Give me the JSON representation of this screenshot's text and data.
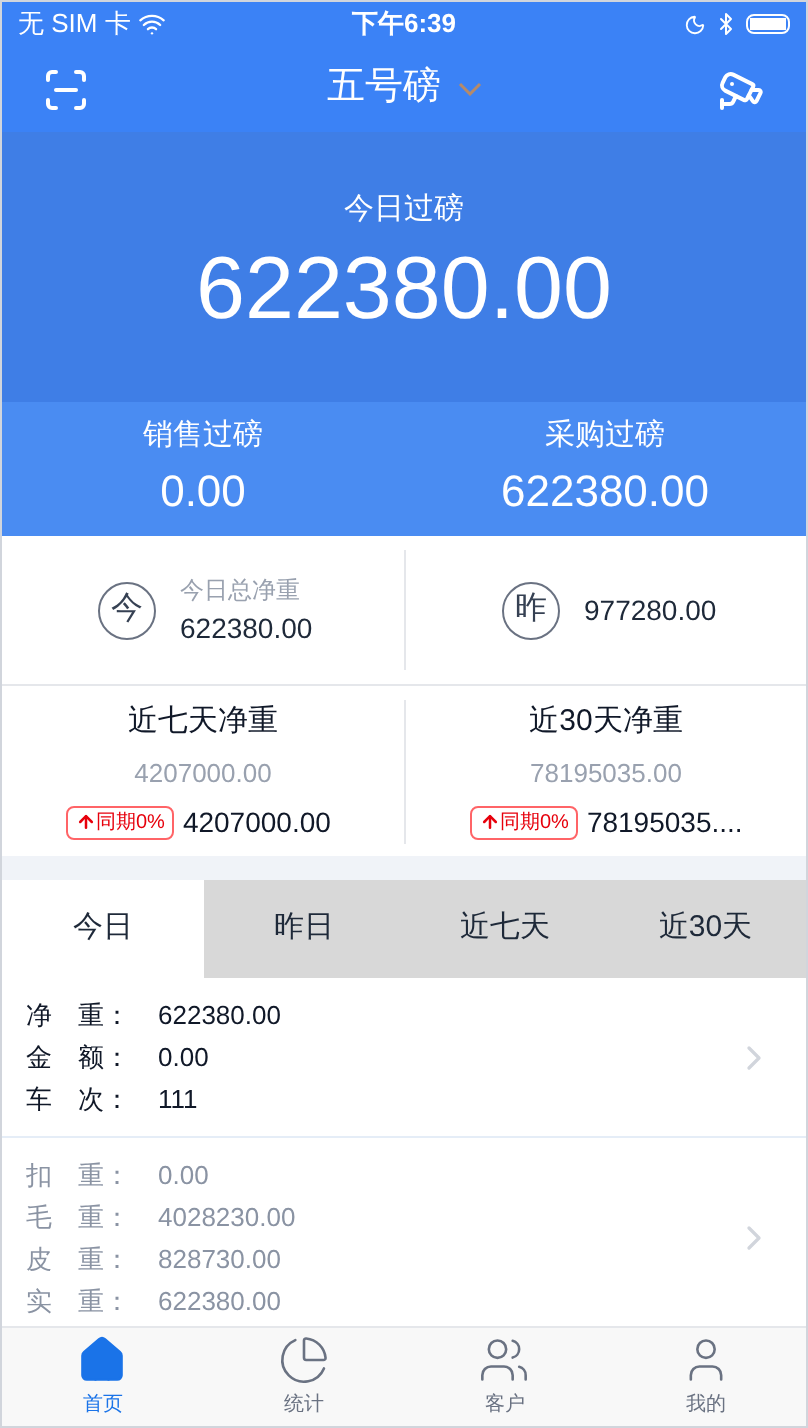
{
  "status_bar": {
    "carrier": "无 SIM 卡",
    "time": "下午6:39"
  },
  "nav": {
    "title": "五号磅"
  },
  "header": {
    "label": "今日过磅",
    "value": "622380.00",
    "sub": [
      {
        "label": "销售过磅",
        "value": "0.00"
      },
      {
        "label": "采购过磅",
        "value": "622380.00"
      }
    ]
  },
  "summary": [
    {
      "badge": "今",
      "label": "今日总净重",
      "value": "622380.00"
    },
    {
      "badge": "昨",
      "value": "977280.00"
    }
  ],
  "periods": [
    {
      "title": "近七天净重",
      "value": "4207000.00",
      "tag": "同期0%",
      "current": "4207000.00"
    },
    {
      "title": "近30天净重",
      "value": "78195035.00",
      "tag": "同期0%",
      "current": "78195035...."
    }
  ],
  "tabs": [
    {
      "label": "今日",
      "selected": true
    },
    {
      "label": "昨日",
      "selected": false
    },
    {
      "label": "近七天",
      "selected": false
    },
    {
      "label": "近30天",
      "selected": false
    }
  ],
  "details": [
    {
      "kind": "primary",
      "rows": [
        {
          "label": "净　重：",
          "value": "622380.00"
        },
        {
          "label": "金　额：",
          "value": "0.00"
        },
        {
          "label": "车　次：",
          "value": "111"
        }
      ]
    },
    {
      "kind": "secondary",
      "rows": [
        {
          "label": "扣　重：",
          "value": "0.00"
        },
        {
          "label": "毛　重：",
          "value": "4028230.00"
        },
        {
          "label": "皮　重：",
          "value": "828730.00"
        },
        {
          "label": "实　重：",
          "value": "622380.00"
        }
      ]
    }
  ],
  "tab_bar": [
    {
      "label": "首页",
      "selected": true
    },
    {
      "label": "统计",
      "selected": false
    },
    {
      "label": "客户",
      "selected": false
    },
    {
      "label": "我的",
      "selected": false
    }
  ]
}
